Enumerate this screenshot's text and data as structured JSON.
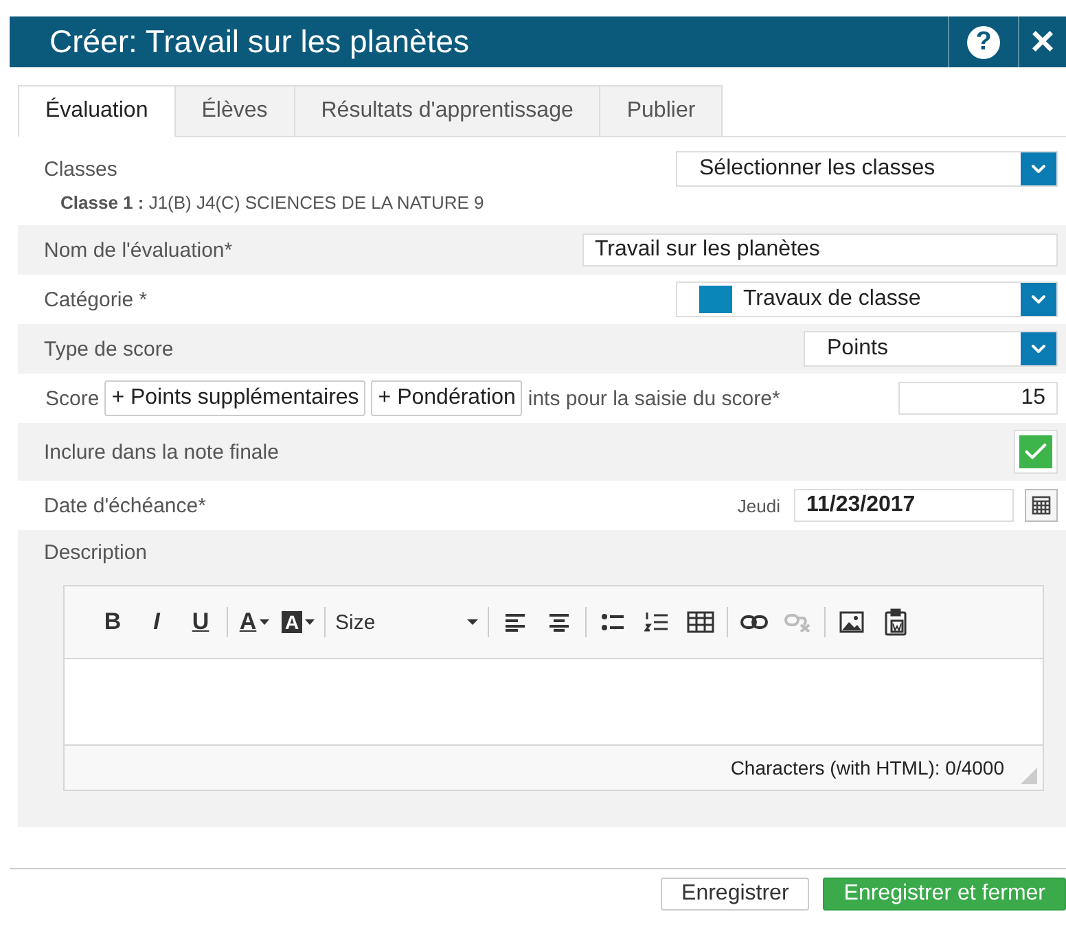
{
  "window": {
    "title": "Créer: Travail sur les planètes",
    "help": "?",
    "close": "×"
  },
  "tabs": [
    {
      "label": "Évaluation",
      "selected": true
    },
    {
      "label": "Élèves",
      "selected": false
    },
    {
      "label": "Résultats d'apprentissage",
      "selected": false
    },
    {
      "label": "Publier",
      "selected": false
    }
  ],
  "classes": {
    "label": "Classes",
    "select": "Sélectionner les classes",
    "detail_label": "Classe 1 :",
    "detail_value": "J1(B) J4(C) SCIENCES DE LA NATURE 9"
  },
  "name": {
    "label": "Nom de l'évaluation*",
    "value": "Travail sur les planètes"
  },
  "category": {
    "label": "Catégorie *",
    "value": "Travaux de classe",
    "color": "#0a86b8"
  },
  "score_type": {
    "label": "Type de score",
    "value": "Points"
  },
  "score": {
    "label": "Score",
    "extra_button": "+ Points supplémentaires",
    "weight_button": "+ Pondération",
    "points_label": "ints pour la saisie du score*",
    "value": "15"
  },
  "include_final": {
    "label": "Inclure dans la note finale",
    "checked": true
  },
  "due_date": {
    "label": "Date d'échéance*",
    "day": "Jeudi",
    "value": "11/23/2017"
  },
  "description": {
    "label": "Description",
    "toolbar": [
      [
        {
          "kind": "bold",
          "label": "B",
          "disabled": false
        },
        {
          "kind": "italic",
          "label": "I",
          "disabled": false
        },
        {
          "kind": "underline",
          "label": "U",
          "disabled": false
        }
      ],
      [
        {
          "kind": "text-color",
          "label": "A",
          "disabled": false
        },
        {
          "kind": "bg-color",
          "label": "A",
          "disabled": false
        }
      ],
      [
        {
          "kind": "size",
          "label": "Size",
          "disabled": false
        }
      ],
      [
        {
          "kind": "align-left",
          "disabled": false
        },
        {
          "kind": "align-center",
          "disabled": false
        }
      ],
      [
        {
          "kind": "bullets",
          "disabled": false
        },
        {
          "kind": "numbers",
          "disabled": false
        },
        {
          "kind": "table",
          "disabled": false
        }
      ],
      [
        {
          "kind": "link",
          "disabled": false
        },
        {
          "kind": "unlink",
          "disabled": true
        }
      ],
      [
        {
          "kind": "image",
          "disabled": false
        },
        {
          "kind": "paste-word",
          "disabled": false
        }
      ]
    ],
    "counter": "Characters (with HTML): 0/4000"
  },
  "buttons": [
    {
      "label": "Enregistrer",
      "kind": "secondary"
    },
    {
      "label": "Enregistrer et fermer",
      "kind": "primary"
    }
  ]
}
